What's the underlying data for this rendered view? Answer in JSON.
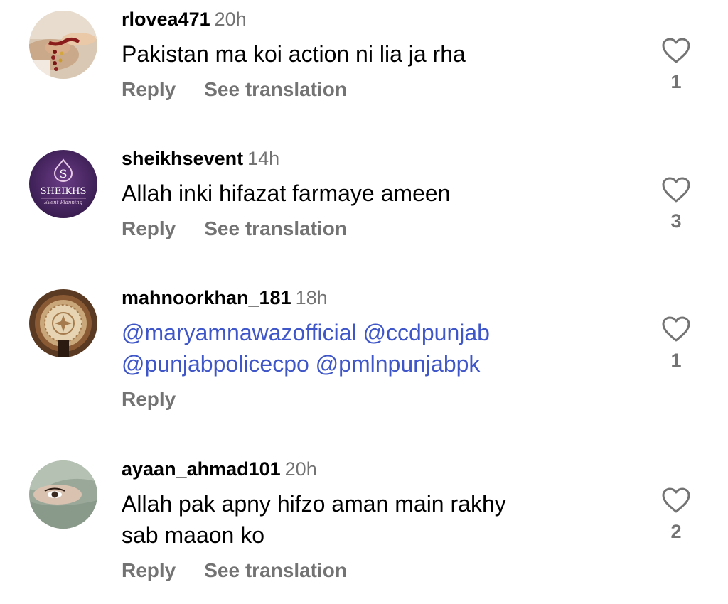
{
  "comments": [
    {
      "username": "rlovea471",
      "time": "20h",
      "text_lines": [
        "Pakistan ma koi action ni lia ja rha"
      ],
      "actions": [
        "Reply",
        "See translation"
      ],
      "likes": "1",
      "avatar_icon": "avatar-hands-icon"
    },
    {
      "username": "sheikhsevent",
      "time": "14h",
      "text_lines": [
        "Allah inki hifazat farmaye ameen"
      ],
      "actions": [
        "Reply",
        "See translation"
      ],
      "likes": "3",
      "avatar_icon": "avatar-sheikhs-logo-icon",
      "avatar_logo_letter": "S",
      "avatar_logo_name": "SHEIKHS",
      "avatar_logo_tagline": "Event Planning"
    },
    {
      "username": "mahnoorkhan_181",
      "time": "18h",
      "mention_lines": [
        [
          "maryamnawazofficial",
          "ccdpunjab"
        ],
        [
          "punjabpolicecpo",
          "pmlnpunjabpk"
        ]
      ],
      "actions": [
        "Reply"
      ],
      "likes": "1",
      "avatar_icon": "avatar-ornament-icon"
    },
    {
      "username": "ayaan_ahmad101",
      "time": "20h",
      "text_lines": [
        "Allah pak apny hifzo aman main rakhy",
        "sab maaon ko"
      ],
      "actions": [
        "Reply",
        "See translation"
      ],
      "likes": "2",
      "avatar_icon": "avatar-veiled-face-icon"
    }
  ],
  "colors": {
    "text": "#000000",
    "secondary": "#737373",
    "mention": "#3f56c8",
    "background": "#ffffff"
  },
  "icons": {
    "like": "heart-outline-icon"
  }
}
